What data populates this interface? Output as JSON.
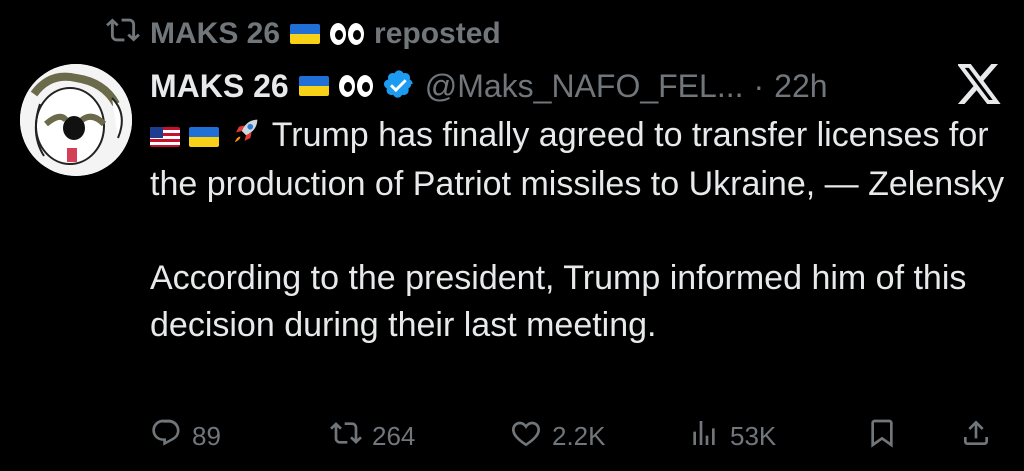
{
  "repost_banner": {
    "text": "MAKS 26",
    "suffix": "reposted"
  },
  "post": {
    "author_name": "MAKS 26",
    "handle": "@Maks_NAFO_FEL...",
    "separator": "·",
    "time": "22h",
    "paragraph1": "Trump has finally agreed to transfer licenses for the production of Patriot missiles to Ukraine, — Zelensky",
    "paragraph2": "According to the president, Trump informed him of this decision during their last meeting."
  },
  "actions": {
    "replies": "89",
    "reposts": "264",
    "likes": "2.2K",
    "views": "53K"
  },
  "icons": [
    "repost-icon",
    "verified-badge-icon",
    "x-logo-icon",
    "reply-icon",
    "like-icon",
    "views-icon",
    "bookmark-icon",
    "share-icon"
  ],
  "colors": {
    "background": "#000000",
    "text": "#e7e9ea",
    "muted": "#71767b",
    "verified": "#1d9bf0"
  }
}
